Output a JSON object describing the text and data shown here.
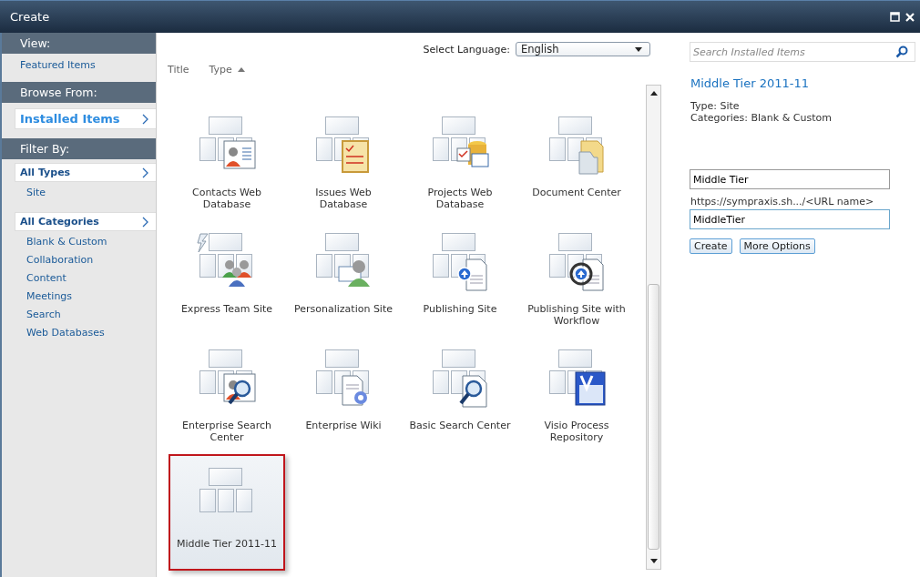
{
  "window": {
    "title": "Create"
  },
  "sidebar": {
    "sections": [
      {
        "header": "View:",
        "items": [
          {
            "label": "Featured Items",
            "selected": false,
            "kind": "link"
          }
        ]
      },
      {
        "header": "Browse From:",
        "items": [
          {
            "label": "Installed Items",
            "selected": true,
            "kind": "big"
          }
        ]
      },
      {
        "header": "Filter By:",
        "items": [
          {
            "label": "All Types",
            "selected": true,
            "kind": "filter"
          },
          {
            "label": "Site",
            "selected": false,
            "kind": "sub"
          },
          {
            "label": "All Categories",
            "selected": true,
            "kind": "filter"
          },
          {
            "label": "Blank & Custom",
            "selected": false,
            "kind": "sub"
          },
          {
            "label": "Collaboration",
            "selected": false,
            "kind": "sub"
          },
          {
            "label": "Content",
            "selected": false,
            "kind": "sub"
          },
          {
            "label": "Meetings",
            "selected": false,
            "kind": "sub"
          },
          {
            "label": "Search",
            "selected": false,
            "kind": "sub"
          },
          {
            "label": "Web Databases",
            "selected": false,
            "kind": "sub"
          }
        ]
      }
    ]
  },
  "language": {
    "label": "Select Language:",
    "value": "English"
  },
  "sort_columns": [
    {
      "label": "Title",
      "sorted": false
    },
    {
      "label": "Type",
      "sorted": true
    }
  ],
  "templates": [
    {
      "title": "Contacts Web Database",
      "selected": false
    },
    {
      "title": "Issues Web Database",
      "selected": false
    },
    {
      "title": "Projects Web Database",
      "selected": false
    },
    {
      "title": "Document Center",
      "selected": false
    },
    {
      "title": "Express Team Site",
      "selected": false
    },
    {
      "title": "Personalization Site",
      "selected": false
    },
    {
      "title": "Publishing Site",
      "selected": false
    },
    {
      "title": "Publishing Site with Workflow",
      "selected": false
    },
    {
      "title": "Enterprise Search Center",
      "selected": false
    },
    {
      "title": "Enterprise Wiki",
      "selected": false
    },
    {
      "title": "Basic Search Center",
      "selected": false
    },
    {
      "title": "Visio Process Repository",
      "selected": false
    },
    {
      "title": "Middle Tier 2011-11",
      "selected": true
    }
  ],
  "details": {
    "search_placeholder": "Search Installed Items",
    "title": "Middle Tier 2011-11",
    "type": "Type: Site",
    "categories": "Categories: Blank & Custom",
    "name_value": "Middle Tier",
    "url_label": "https://sympraxis.sh.../<URL name>",
    "url_value": "MiddleTier",
    "buttons": [
      "Create",
      "More Options"
    ]
  }
}
